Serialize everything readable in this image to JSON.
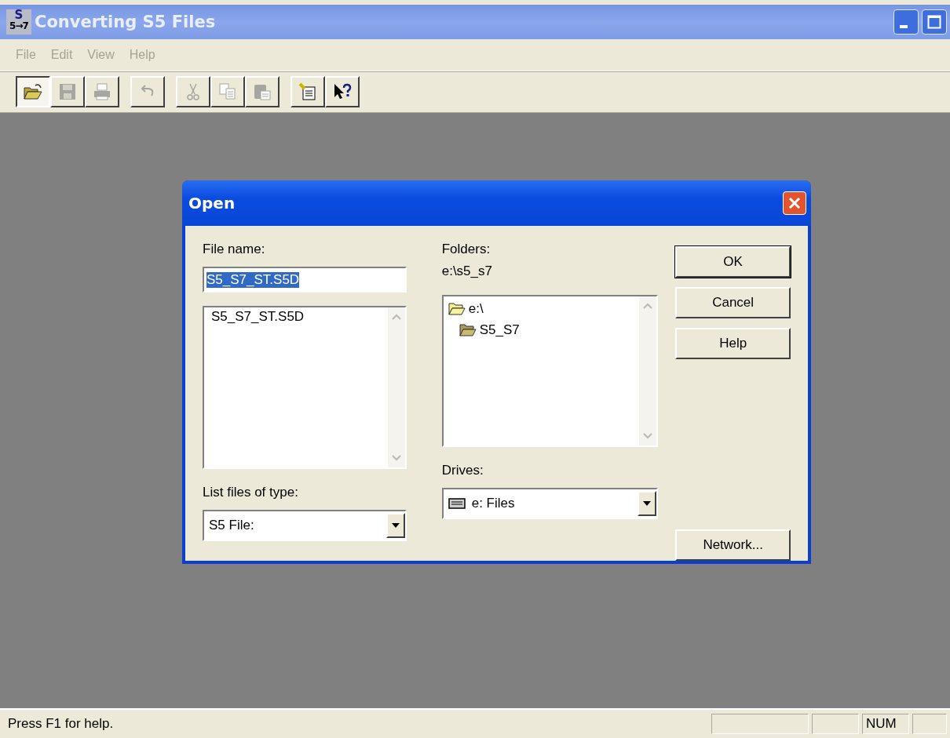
{
  "window": {
    "title": "Converting S5 Files",
    "app_icon": {
      "top": "S",
      "bottom": "5→7"
    }
  },
  "menu": [
    {
      "label": "File",
      "disabled": true
    },
    {
      "label": "Edit",
      "disabled": true
    },
    {
      "label": "View",
      "disabled": true
    },
    {
      "label": "Help",
      "disabled": true
    }
  ],
  "toolbar": [
    {
      "kind": "open",
      "disabled": false,
      "pressed": true
    },
    {
      "kind": "save",
      "disabled": true,
      "pressed": false
    },
    {
      "kind": "print",
      "disabled": true,
      "pressed": false
    },
    {
      "kind": "undo",
      "disabled": true,
      "pressed": false
    },
    {
      "kind": "cut",
      "disabled": true,
      "pressed": false
    },
    {
      "kind": "copy",
      "disabled": true,
      "pressed": false
    },
    {
      "kind": "paste",
      "disabled": true,
      "pressed": false
    },
    {
      "kind": "note",
      "disabled": false,
      "pressed": false
    },
    {
      "kind": "help",
      "disabled": false,
      "pressed": false
    }
  ],
  "dialog": {
    "title": "Open",
    "file_name": {
      "label": "File name:",
      "value": "S5_S7_ST.S5D",
      "selected": true
    },
    "files": [
      {
        "name": "S5_S7_ST.S5D",
        "selected": false
      }
    ],
    "folders": {
      "label": "Folders:",
      "path": "e:\\s5_s7",
      "tree": [
        {
          "name": "e:\\",
          "expanded": true,
          "children": [
            {
              "name": "S5_S7",
              "expanded": true
            }
          ]
        }
      ]
    },
    "file_type": {
      "label": "List files of type:",
      "value": "S5 File:"
    },
    "drives": {
      "label": "Drives:",
      "value": "e: Files"
    },
    "buttons": [
      {
        "label": "OK",
        "default": true
      },
      {
        "label": "Cancel",
        "default": false
      },
      {
        "label": "Help",
        "default": false
      }
    ],
    "network_button": "Network..."
  },
  "status_bar": {
    "message": "Press F1 for help.",
    "indicators": [
      "NUM"
    ]
  }
}
